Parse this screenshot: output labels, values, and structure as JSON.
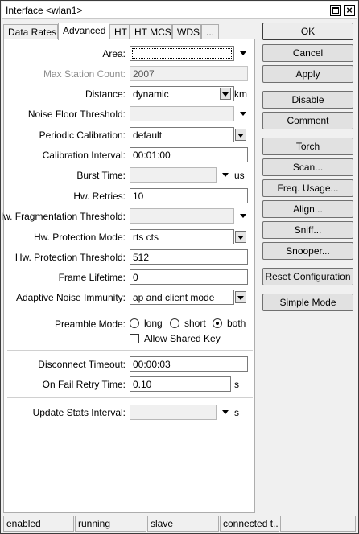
{
  "window": {
    "title": "Interface <wlan1>"
  },
  "tabs": [
    "Data Rates",
    "Advanced",
    "HT",
    "HT MCS",
    "WDS",
    "..."
  ],
  "active_tab": "Advanced",
  "form": {
    "area": {
      "label": "Area:",
      "value": ""
    },
    "max_station_count": {
      "label": "Max Station Count:",
      "value": "2007"
    },
    "distance": {
      "label": "Distance:",
      "value": "dynamic",
      "unit": "km"
    },
    "noise_floor_threshold": {
      "label": "Noise Floor Threshold:",
      "value": ""
    },
    "periodic_calibration": {
      "label": "Periodic Calibration:",
      "value": "default"
    },
    "calibration_interval": {
      "label": "Calibration Interval:",
      "value": "00:01:00"
    },
    "burst_time": {
      "label": "Burst Time:",
      "value": "",
      "unit": "us"
    },
    "hw_retries": {
      "label": "Hw. Retries:",
      "value": "10"
    },
    "hw_fragmentation_threshold": {
      "label": "Hw. Fragmentation Threshold:",
      "value": ""
    },
    "hw_protection_mode": {
      "label": "Hw. Protection Mode:",
      "value": "rts cts"
    },
    "hw_protection_threshold": {
      "label": "Hw. Protection Threshold:",
      "value": "512"
    },
    "frame_lifetime": {
      "label": "Frame Lifetime:",
      "value": "0"
    },
    "adaptive_noise_immunity": {
      "label": "Adaptive Noise Immunity:",
      "value": "ap and client mode"
    },
    "preamble_mode": {
      "label": "Preamble Mode:",
      "options": [
        "long",
        "short",
        "both"
      ],
      "selected": "both"
    },
    "allow_shared_key": {
      "label": "Allow Shared Key",
      "checked": false
    },
    "disconnect_timeout": {
      "label": "Disconnect Timeout:",
      "value": "00:00:03"
    },
    "on_fail_retry_time": {
      "label": "On Fail Retry Time:",
      "value": "0.10",
      "unit": "s"
    },
    "update_stats_interval": {
      "label": "Update Stats Interval:",
      "value": "",
      "unit": "s"
    }
  },
  "buttons": {
    "ok": "OK",
    "cancel": "Cancel",
    "apply": "Apply",
    "disable": "Disable",
    "comment": "Comment",
    "torch": "Torch",
    "scan": "Scan...",
    "freq_usage": "Freq. Usage...",
    "align": "Align...",
    "sniff": "Sniff...",
    "snooper": "Snooper...",
    "reset_configuration": "Reset Configuration",
    "simple_mode": "Simple Mode"
  },
  "status_bar": [
    "enabled",
    "running",
    "slave",
    "connected t..."
  ]
}
